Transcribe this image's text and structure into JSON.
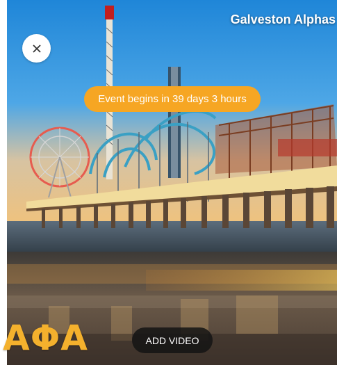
{
  "header": {
    "title": "Galveston Alphas"
  },
  "close_button": {
    "icon": "close-icon"
  },
  "event": {
    "countdown_text": "Event begins in 39 days 3 hours"
  },
  "overlay": {
    "letters": "ΑΦΑ"
  },
  "actions": {
    "add_video_label": "ADD VIDEO"
  },
  "colors": {
    "accent": "#f6a623",
    "letters": "#f4b12d",
    "button_dark": "#1a1a1a"
  }
}
